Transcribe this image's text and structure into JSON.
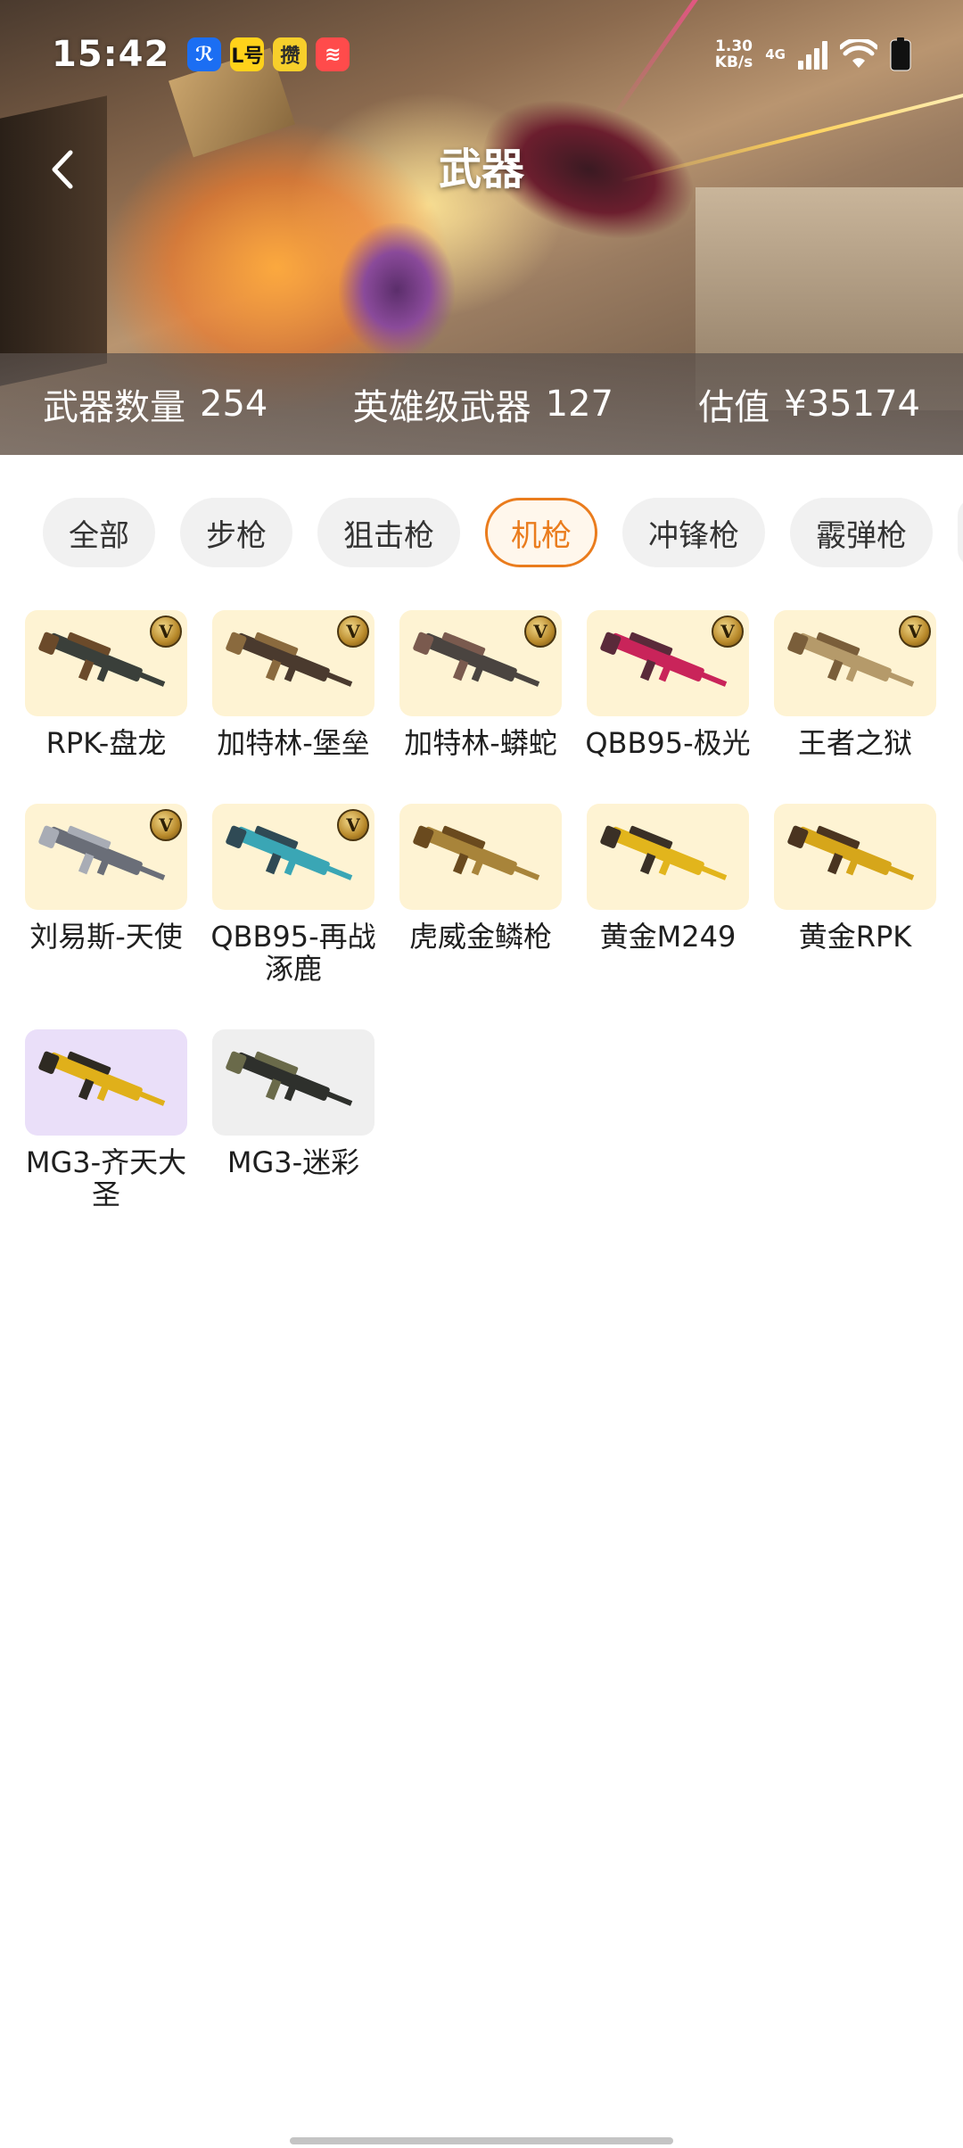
{
  "status_bar": {
    "time": "15:42",
    "apps": [
      {
        "icon": "blue-app-icon",
        "glyph": "ℛ",
        "bg": "#1b6ef3",
        "fg": "#ffffff"
      },
      {
        "icon": "yellow-app-icon",
        "glyph": "L号",
        "bg": "#ffd21a",
        "fg": "#111111"
      },
      {
        "icon": "yellow-app-icon-2",
        "glyph": "攒",
        "bg": "#f7cf2b",
        "fg": "#2b2b2b"
      },
      {
        "icon": "red-app-icon",
        "glyph": "≋",
        "bg": "#ff4b4b",
        "fg": "#ffffff"
      }
    ],
    "speed_value": "1.30",
    "speed_unit": "KB/s",
    "network": "4G"
  },
  "header": {
    "title": "武器"
  },
  "stats": {
    "count_label": "武器数量",
    "count_value": "254",
    "hero_label": "英雄级武器",
    "hero_value": "127",
    "value_label": "估值",
    "value_value": "¥35174"
  },
  "tabs": [
    {
      "label": "全部",
      "active": false
    },
    {
      "label": "步枪",
      "active": false
    },
    {
      "label": "狙击枪",
      "active": false
    },
    {
      "label": "机枪",
      "active": true
    },
    {
      "label": "冲锋枪",
      "active": false
    },
    {
      "label": "霰弹枪",
      "active": false
    }
  ],
  "weapons": [
    {
      "name": "RPK-盘龙",
      "badge": "V",
      "bg": "yellow",
      "gun_color": "#3a3f3a",
      "accent": "#6b4a2a"
    },
    {
      "name": "加特林-堡垒",
      "badge": "V",
      "bg": "yellow",
      "gun_color": "#4a3a2e",
      "accent": "#8a6a3e"
    },
    {
      "name": "加特林-蟒蛇",
      "badge": "V",
      "bg": "yellow",
      "gun_color": "#4a4440",
      "accent": "#7a5a4e"
    },
    {
      "name": "QBB95-极光",
      "badge": "V",
      "bg": "yellow",
      "gun_color": "#c9245a",
      "accent": "#5a2a3a"
    },
    {
      "name": "王者之狱",
      "badge": "V",
      "bg": "yellow",
      "gun_color": "#b59a6a",
      "accent": "#7a5e3a"
    },
    {
      "name": "刘易斯-天使",
      "badge": "V",
      "bg": "yellow",
      "gun_color": "#6a6e78",
      "accent": "#a8acb5"
    },
    {
      "name": "QBB95-再战涿鹿",
      "badge": "V",
      "bg": "yellow",
      "gun_color": "#3aa6b5",
      "accent": "#2f4a55"
    },
    {
      "name": "虎威金鳞枪",
      "badge": "",
      "bg": "yellow",
      "gun_color": "#a8843a",
      "accent": "#6a4a1e"
    },
    {
      "name": "黄金M249",
      "badge": "",
      "bg": "yellow",
      "gun_color": "#e2b51c",
      "accent": "#3a3026"
    },
    {
      "name": "黄金RPK",
      "badge": "",
      "bg": "yellow",
      "gun_color": "#d6a61a",
      "accent": "#4a3420"
    },
    {
      "name": "MG3-齐天大圣",
      "badge": "",
      "bg": "purple",
      "gun_color": "#e0b01a",
      "accent": "#2e2a22"
    },
    {
      "name": "MG3-迷彩",
      "badge": "",
      "bg": "gray",
      "gun_color": "#2e302c",
      "accent": "#6a6a4a"
    }
  ]
}
